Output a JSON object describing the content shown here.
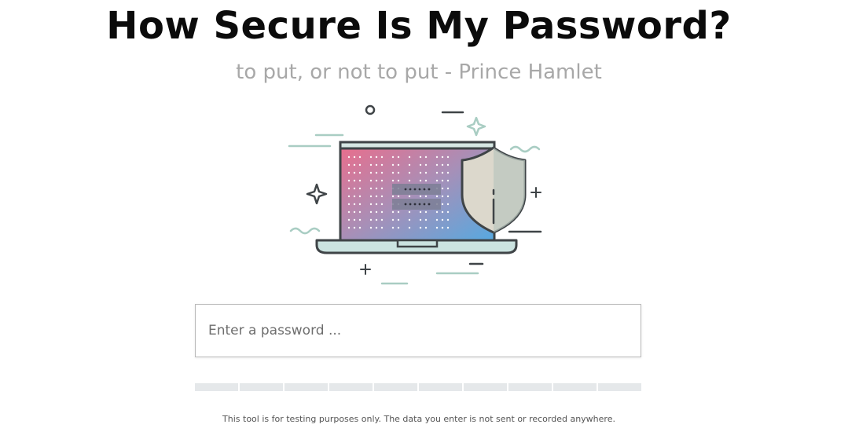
{
  "header": {
    "title": "How Secure Is My Password?",
    "subtitle": "to put, or not to put - Prince Hamlet"
  },
  "illustration": {
    "icon": "laptop-shield-illustration",
    "screen_gradient": [
      "#e8738e",
      "#a98bb4",
      "#5fa8dc"
    ],
    "shield_color": "#dcd8cc",
    "accent_lines": "#a9cdc3",
    "outline": "#3f4447"
  },
  "password_field": {
    "placeholder": "Enter a password ...",
    "value": ""
  },
  "strength_meter": {
    "segments": 10,
    "filled": 0,
    "empty_color": "#e5e8ea"
  },
  "footer": {
    "disclaimer": "This tool is for testing purposes only. The data you enter is not sent or recorded anywhere."
  }
}
